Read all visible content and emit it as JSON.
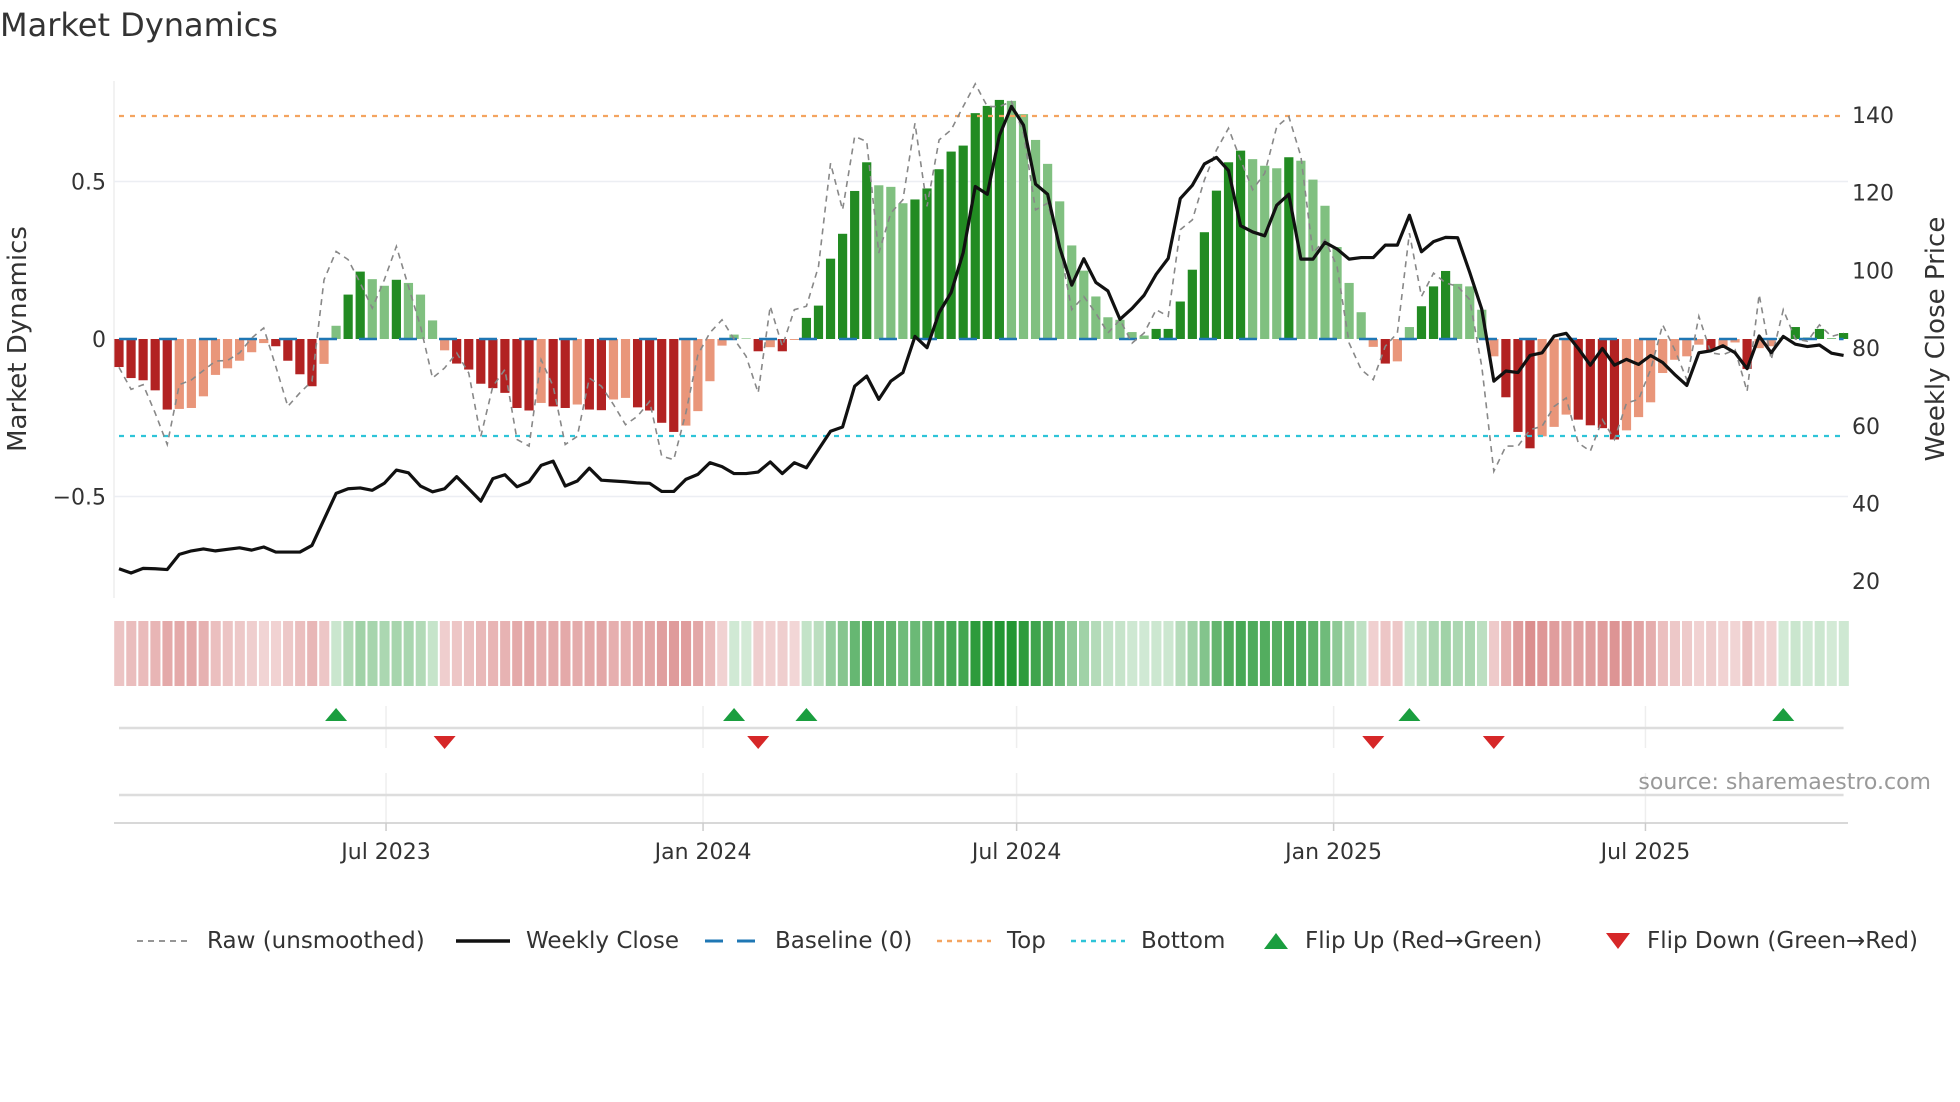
{
  "chart_data": {
    "type": "bar",
    "title": "Market Dynamics",
    "ylabel": "Market Dynamics",
    "y2label": "Weekly Close Price",
    "frequency": "weekly",
    "start_date": "2023-01-27",
    "ylim": [
      -0.82,
      0.82
    ],
    "y2lim": [
      15.8,
      148.7
    ],
    "yticks": [
      {
        "v": 0.5,
        "label": "0.5"
      },
      {
        "v": 0,
        "label": "0"
      },
      {
        "v": -0.5,
        "label": "−0.5"
      }
    ],
    "y2ticks": [
      {
        "v": 140,
        "label": "140"
      },
      {
        "v": 120,
        "label": "120"
      },
      {
        "v": 100,
        "label": "100"
      },
      {
        "v": 80,
        "label": "80"
      },
      {
        "v": 60,
        "label": "60"
      },
      {
        "v": 40,
        "label": "40"
      },
      {
        "v": 20,
        "label": "20"
      }
    ],
    "xticks": [
      {
        "date": "2023-07-01",
        "label": "Jul 2023"
      },
      {
        "date": "2024-01-01",
        "label": "Jan 2024"
      },
      {
        "date": "2024-07-01",
        "label": "Jul 2024"
      },
      {
        "date": "2025-01-01",
        "label": "Jan 2025"
      },
      {
        "date": "2025-07-01",
        "label": "Jul 2025"
      }
    ],
    "top_level": 0.708,
    "bottom_level": -0.308,
    "baseline": 0,
    "grid": true,
    "legend_position": "bottom",
    "series": [
      {
        "name": "Market Dynamics (smoothed)",
        "type": "bar",
        "values": [
          -0.089,
          -0.124,
          -0.131,
          -0.163,
          -0.224,
          -0.222,
          -0.219,
          -0.182,
          -0.114,
          -0.093,
          -0.069,
          -0.042,
          -0.013,
          -0.023,
          -0.069,
          -0.112,
          -0.15,
          -0.079,
          0.042,
          0.141,
          0.214,
          0.19,
          0.169,
          0.188,
          0.178,
          0.141,
          0.059,
          -0.036,
          -0.078,
          -0.097,
          -0.142,
          -0.156,
          -0.171,
          -0.219,
          -0.227,
          -0.203,
          -0.214,
          -0.219,
          -0.208,
          -0.224,
          -0.226,
          -0.192,
          -0.187,
          -0.217,
          -0.227,
          -0.266,
          -0.295,
          -0.275,
          -0.229,
          -0.134,
          -0.021,
          0.014,
          0.002,
          -0.039,
          -0.026,
          -0.039,
          -0.003,
          0.067,
          0.106,
          0.255,
          0.334,
          0.47,
          0.561,
          0.488,
          0.483,
          0.431,
          0.443,
          0.478,
          0.539,
          0.595,
          0.614,
          0.717,
          0.74,
          0.759,
          0.756,
          0.714,
          0.632,
          0.556,
          0.437,
          0.297,
          0.217,
          0.135,
          0.069,
          0.061,
          0.022,
          0.011,
          0.032,
          0.032,
          0.119,
          0.22,
          0.339,
          0.471,
          0.561,
          0.598,
          0.571,
          0.55,
          0.542,
          0.577,
          0.566,
          0.506,
          0.423,
          0.292,
          0.178,
          0.085,
          -0.025,
          -0.078,
          -0.071,
          0.038,
          0.104,
          0.167,
          0.216,
          0.175,
          0.167,
          0.093,
          -0.055,
          -0.185,
          -0.295,
          -0.347,
          -0.309,
          -0.279,
          -0.24,
          -0.256,
          -0.274,
          -0.283,
          -0.319,
          -0.29,
          -0.248,
          -0.201,
          -0.108,
          -0.066,
          -0.055,
          -0.018,
          -0.036,
          -0.023,
          -0.011,
          -0.095,
          -0.029,
          -0.023,
          0.004,
          0.038,
          0.005,
          0.032,
          0.003,
          0.019
        ]
      },
      {
        "name": "Raw (unsmoothed)",
        "type": "line",
        "values": [
          -0.09,
          -0.16,
          -0.145,
          -0.235,
          -0.335,
          -0.145,
          -0.13,
          -0.1,
          -0.07,
          -0.068,
          -0.044,
          0.003,
          0.035,
          -0.087,
          -0.214,
          -0.171,
          -0.134,
          0.188,
          0.278,
          0.252,
          0.178,
          0.098,
          0.188,
          0.294,
          0.167,
          0.04,
          -0.124,
          -0.092,
          -0.044,
          -0.108,
          -0.309,
          -0.15,
          -0.097,
          -0.319,
          -0.34,
          -0.066,
          -0.15,
          -0.335,
          -0.309,
          -0.124,
          -0.15,
          -0.208,
          -0.272,
          -0.245,
          -0.198,
          -0.372,
          -0.383,
          -0.235,
          -0.05,
          0.02,
          0.061,
          0.0,
          -0.055,
          -0.171,
          0.104,
          -0.023,
          0.093,
          0.104,
          0.23,
          0.558,
          0.41,
          0.643,
          0.627,
          0.273,
          0.4,
          0.442,
          0.685,
          0.421,
          0.632,
          0.664,
          0.738,
          0.81,
          0.738,
          0.738,
          0.754,
          0.653,
          0.41,
          0.431,
          0.294,
          0.093,
          0.135,
          0.082,
          0.019,
          0.061,
          -0.013,
          0.019,
          0.093,
          0.072,
          0.347,
          0.378,
          0.505,
          0.6,
          0.669,
          0.569,
          0.474,
          0.526,
          0.674,
          0.706,
          0.58,
          0.273,
          0.315,
          0.23,
          -0.013,
          -0.097,
          -0.129,
          -0.023,
          0.019,
          0.336,
          0.135,
          0.209,
          0.178,
          0.167,
          0.125,
          -0.087,
          -0.42,
          -0.34,
          -0.34,
          -0.288,
          -0.277,
          -0.214,
          -0.187,
          -0.33,
          -0.356,
          -0.256,
          -0.319,
          -0.203,
          -0.192,
          -0.097,
          0.045,
          -0.034,
          -0.129,
          0.072,
          -0.044,
          -0.05,
          -0.034,
          -0.166,
          0.141,
          -0.066,
          0.093,
          0.0,
          -0.007,
          0.045,
          0.008,
          0.019
        ]
      },
      {
        "name": "Weekly Close",
        "type": "line",
        "axis": "right",
        "values": [
          23.2,
          22.1,
          23.3,
          23.2,
          23.0,
          26.9,
          27.8,
          28.3,
          27.8,
          28.2,
          28.6,
          28.0,
          28.8,
          27.5,
          27.5,
          27.5,
          29.2,
          35.9,
          42.6,
          43.8,
          44.0,
          43.4,
          45.2,
          48.6,
          47.9,
          44.5,
          43.0,
          43.8,
          46.9,
          43.8,
          40.6,
          46.4,
          47.4,
          44.3,
          45.6,
          49.8,
          50.9,
          44.5,
          45.8,
          49.1,
          46.0,
          45.8,
          45.6,
          45.3,
          45.2,
          43.1,
          43.1,
          46.2,
          47.5,
          50.5,
          49.5,
          47.7,
          47.7,
          48.1,
          50.7,
          47.7,
          50.5,
          49.2,
          53.9,
          58.6,
          59.7,
          70.2,
          72.8,
          66.8,
          71.5,
          73.7,
          83.0,
          80.1,
          89.1,
          94.3,
          104.6,
          121.6,
          119.6,
          134.7,
          142.2,
          137.4,
          122.2,
          119.6,
          105.9,
          96.2,
          103.0,
          96.9,
          94.7,
          87.4,
          90.2,
          93.6,
          99.0,
          103.1,
          118.5,
          121.9,
          127.4,
          129.1,
          125.7,
          111.5,
          109.9,
          108.9,
          116.8,
          119.6,
          102.9,
          102.9,
          107.2,
          105.5,
          102.9,
          103.3,
          103.3,
          106.5,
          106.5,
          114.2,
          104.8,
          107.4,
          108.5,
          108.4,
          99.5,
          90.0,
          71.5,
          74.1,
          73.7,
          78.1,
          78.8,
          83.1,
          83.8,
          79.9,
          75.6,
          79.9,
          75.6,
          77.1,
          75.8,
          78.1,
          76.3,
          73.2,
          70.4,
          78.8,
          79.3,
          80.6,
          78.8,
          74.7,
          83.1,
          78.8,
          83.0,
          81.0,
          80.4,
          80.8,
          78.7,
          78.1
        ]
      }
    ],
    "flip_up_weeks": [
      18,
      51,
      57,
      107,
      138
    ],
    "flip_down_weeks": [
      27,
      53,
      104,
      114
    ],
    "colors": {
      "pos_strong": "#228b22",
      "pos_weak": "#80c080",
      "neg_strong": "#b22222",
      "neg_weak": "#e9967a",
      "raw": "#888888",
      "close": "#111111",
      "baseline": "#1f77b4",
      "top": "#f4a460",
      "bottom": "#2ec4d8",
      "flip_up": "#1a9e3f",
      "flip_down": "#d62728"
    },
    "legend": [
      {
        "key": "raw",
        "label": "Raw (unsmoothed)"
      },
      {
        "key": "close",
        "label": "Weekly Close"
      },
      {
        "key": "baseline",
        "label": "Baseline (0)"
      },
      {
        "key": "top",
        "label": "Top"
      },
      {
        "key": "bottom",
        "label": "Bottom"
      },
      {
        "key": "flip_up",
        "label": "Flip Up (Red→Green)"
      },
      {
        "key": "flip_down",
        "label": "Flip Down (Green→Red)"
      }
    ],
    "source": "source: sharemaestro.com"
  }
}
